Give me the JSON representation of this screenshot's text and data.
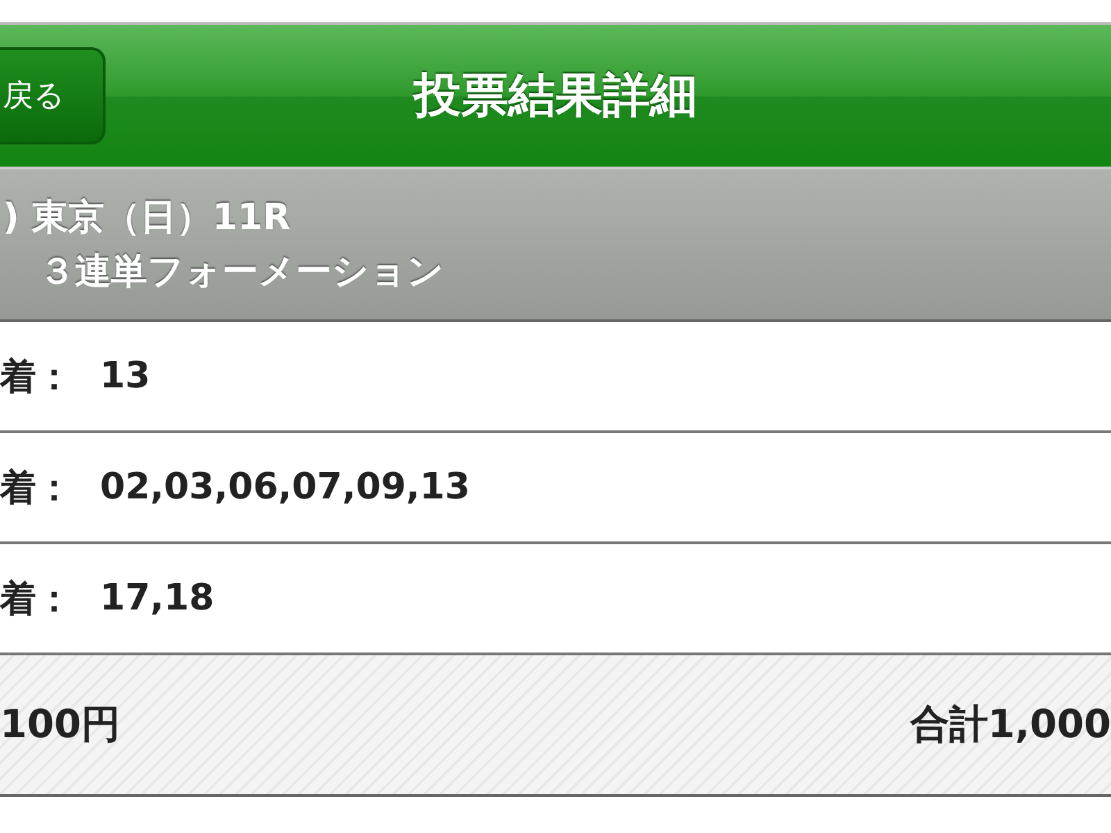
{
  "header": {
    "back_button": "戻る",
    "title": "投票結果詳細"
  },
  "race": {
    "venue": ") 東京（日）11R",
    "bet_type": "３連単フォーメーション"
  },
  "selections": [
    {
      "label": "着：",
      "value": "13"
    },
    {
      "label": "着：",
      "value": "02,03,06,07,09,13"
    },
    {
      "label": "着：",
      "value": "17,18"
    }
  ],
  "footer": {
    "unit_price": "100円",
    "total": "合計1,000"
  }
}
